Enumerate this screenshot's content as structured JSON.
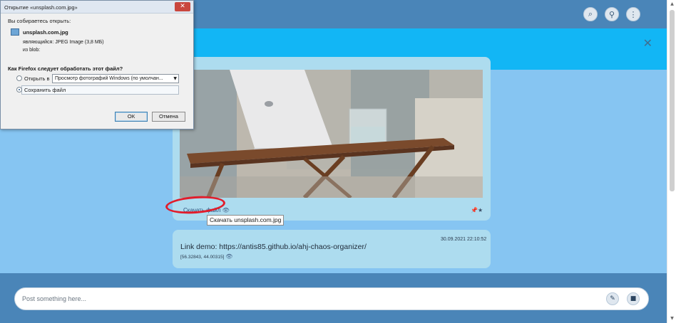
{
  "header": {
    "search_icon": "search-icon",
    "attach_icon": "paperclip-icon",
    "menu_icon": "more-vertical-icon"
  },
  "banner": {
    "close_icon": "close-icon"
  },
  "feed": {
    "image_message": {
      "download_label": "Скачать файл",
      "tooltip": "Скачать unsplash.com.jpg"
    },
    "link_message": {
      "timestamp": "30.09.2021 22:10:52",
      "text": "Link demo: https://antis85.github.io/ahj-chaos-organizer/",
      "coords": "[56.32843, 44.00315]"
    }
  },
  "composer": {
    "placeholder": "Post something here...",
    "mic_icon": "microphone-icon",
    "video_icon": "video-camera-icon"
  },
  "dialog": {
    "title": "Открытие «unsplash.com.jpg»",
    "intro": "Вы собираетесь открыть:",
    "file_name": "unsplash.com.jpg",
    "file_type": "являющийся: JPEG Image (3,8 МБ)",
    "source": "из blob:",
    "question": "Как Firefox следует обработать этот файл?",
    "open_with_label": "Открыть в",
    "open_with_app": "Просмотр фотографий Windows (по умолчан...",
    "save_label": "Сохранить файл",
    "ok_label": "ОК",
    "cancel_label": "Отмена"
  },
  "colors": {
    "header": "#4a85b8",
    "banner": "#12b6f5",
    "feed_bg": "#86c5f2",
    "card": "#addcef",
    "annotation": "#e11d2b"
  }
}
